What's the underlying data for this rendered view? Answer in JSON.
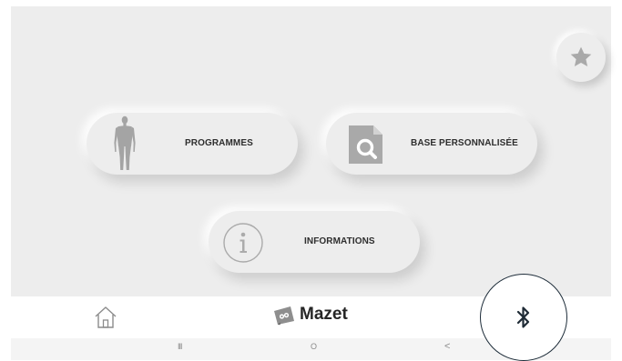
{
  "home": {
    "favorites_icon": "star-icon",
    "buttons": {
      "programmes": {
        "label": "PROGRAMMES",
        "icon": "human-body-icon"
      },
      "base": {
        "label": "BASE PERSONNALISÉE",
        "icon": "document-search-icon"
      },
      "informations": {
        "label": "INFORMATIONS",
        "icon": "info-icon"
      }
    }
  },
  "bottom_nav": {
    "home_icon": "home-icon",
    "brand": "Mazet",
    "bluetooth_icon": "bluetooth-icon"
  },
  "system_nav": {
    "recents": "III",
    "home": "O",
    "back": "<"
  },
  "colors": {
    "background": "#ededed",
    "icon_gray": "#a9a9a9",
    "text_dark": "#2e2e2e",
    "brand_dark": "#262626",
    "bluetooth_ring": "#1e2d3a"
  }
}
